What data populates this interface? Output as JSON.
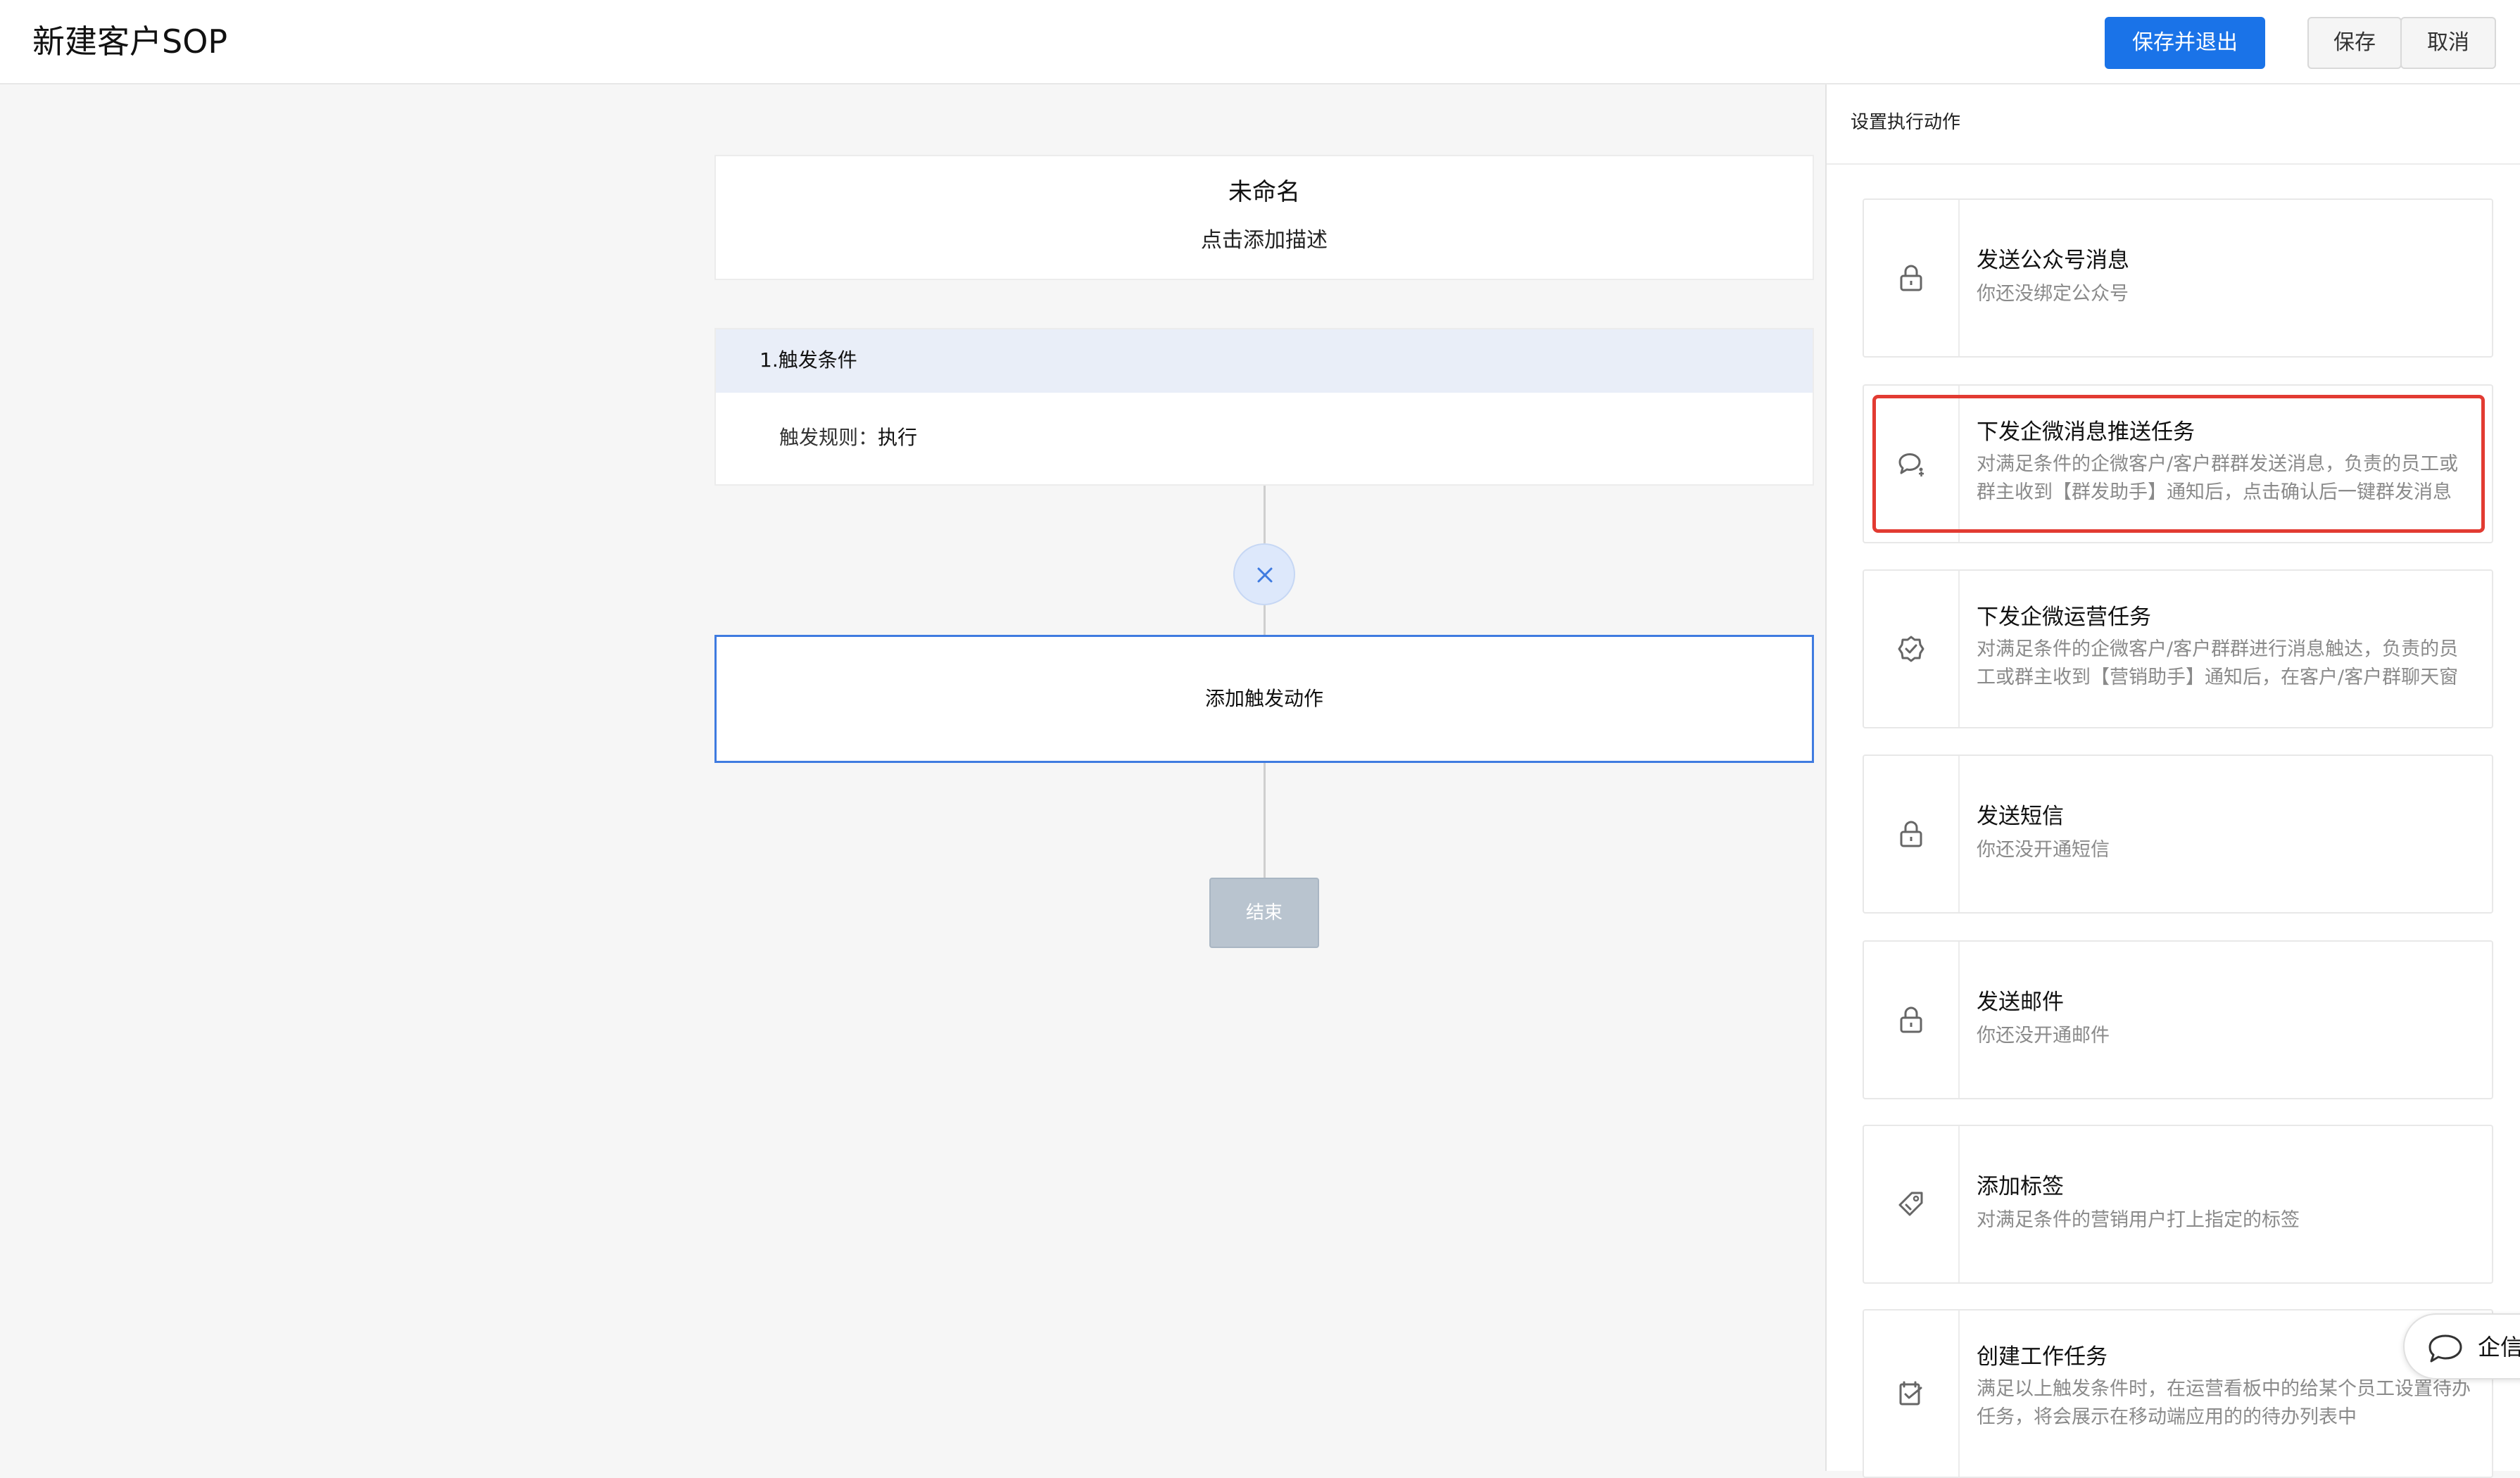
{
  "header": {
    "title": "新建客户SOP",
    "buttons": {
      "save_exit": "保存并退出",
      "save": "保存",
      "cancel": "取消"
    }
  },
  "flow": {
    "title": "未命名",
    "description": "点击添加描述",
    "condition_title": "1.触发条件",
    "rule_label": "触发规则：",
    "rule_value": "执行",
    "add_action": "添加触发动作",
    "end": "结束"
  },
  "panel": {
    "title": "设置执行动作",
    "actions": [
      {
        "title": "发送公众号消息",
        "subtitle": "你还没绑定公众号",
        "icon": "lock-icon"
      },
      {
        "title": "下发企微消息推送任务",
        "subtitle": "对满足条件的企微客户/客户群群发送消息，负责的员工或群主收到【群发助手】通知后，点击确认后一键群发消息到...",
        "icon": "chat-bubble-icon",
        "highlighted": true
      },
      {
        "title": "下发企微运营任务",
        "subtitle": "对满足条件的企微客户/客户群群进行消息触达，负责的员工或群主收到【营销助手】通知后，在客户/客户群聊天窗口...",
        "icon": "badge-check-icon"
      },
      {
        "title": "发送短信",
        "subtitle": "你还没开通短信",
        "icon": "lock-icon"
      },
      {
        "title": "发送邮件",
        "subtitle": "你还没开通邮件",
        "icon": "lock-icon"
      },
      {
        "title": "添加标签",
        "subtitle": "对满足条件的营销用户打上指定的标签",
        "icon": "tag-icon"
      },
      {
        "title": "创建工作任务",
        "subtitle": "满足以上触发条件时，在运营看板中的给某个员工设置待办任务，将会展示在移动端应用的的待办列表中",
        "icon": "task-check-icon"
      }
    ]
  },
  "chat_widget": {
    "label": "企信"
  },
  "colors": {
    "primary": "#1a73e8",
    "highlight_border": "#e23b32",
    "end_button": "#b9c4cf"
  }
}
